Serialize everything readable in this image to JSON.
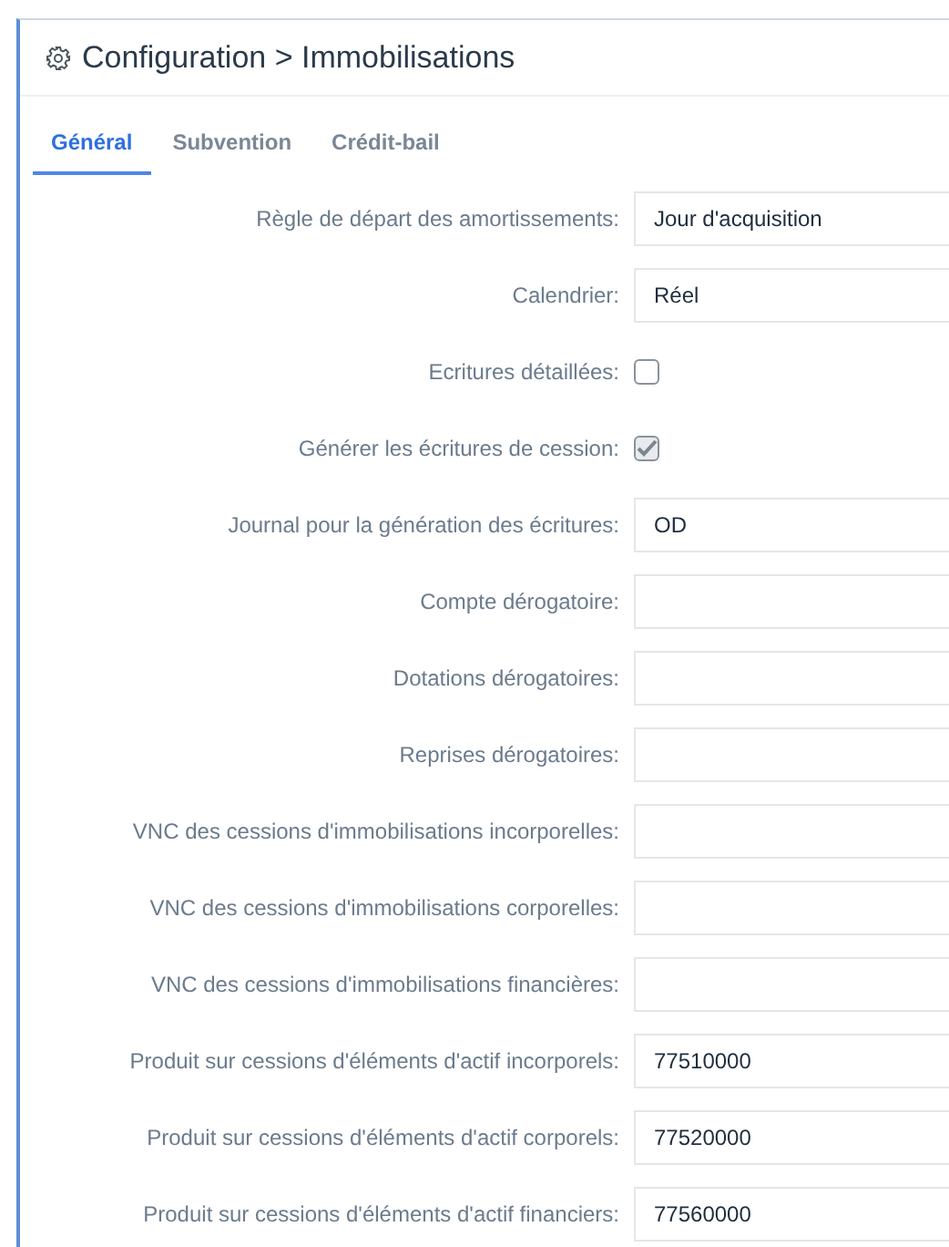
{
  "window": {
    "title": "Configuration > Immobilisations"
  },
  "tabs": [
    {
      "label": "Général",
      "selected": true
    },
    {
      "label": "Subvention",
      "selected": false
    },
    {
      "label": "Crédit-bail",
      "selected": false
    }
  ],
  "rows": [
    {
      "kind": "field",
      "label": "Règle de départ des amortissements:",
      "value": "Jour d'acquisition"
    },
    {
      "kind": "field",
      "label": "Calendrier:",
      "value": "Réel"
    },
    {
      "kind": "checkbox",
      "label": "Ecritures détaillées:",
      "checked": false
    },
    {
      "kind": "checkbox",
      "label": "Générer les écritures de cession:",
      "checked": true
    },
    {
      "kind": "field",
      "label": "Journal pour la génération des écritures:",
      "value": "OD"
    },
    {
      "kind": "field",
      "label": "Compte dérogatoire:"
    },
    {
      "kind": "field",
      "label": "Dotations dérogatoires:"
    },
    {
      "kind": "field",
      "label": "Reprises dérogatoires:"
    },
    {
      "kind": "field",
      "label": "VNC des cessions d'immobilisations incorporelles:"
    },
    {
      "kind": "field",
      "label": "VNC des cessions d'immobilisations corporelles:"
    },
    {
      "kind": "field",
      "label": "VNC des cessions d'immobilisations financières:"
    },
    {
      "kind": "field",
      "label": "Produit sur cessions d'éléments d'actif incorporels:",
      "value": "77510000"
    },
    {
      "kind": "field",
      "label": "Produit sur cessions d'éléments d'actif corporels:",
      "value": "77520000"
    },
    {
      "kind": "field",
      "label": "Produit sur cessions d'éléments d'actif financiers:",
      "value": "77560000"
    }
  ]
}
